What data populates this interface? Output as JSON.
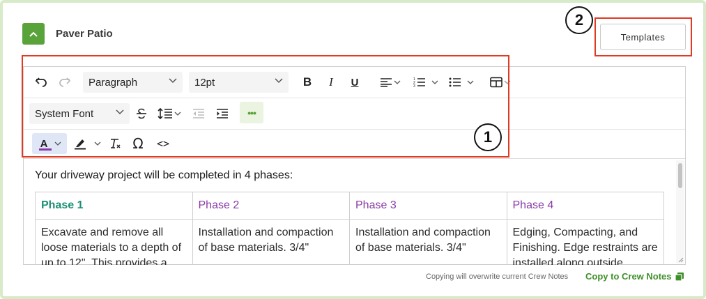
{
  "section": {
    "title": "Paver Patio"
  },
  "templates_button": {
    "label": "Templates"
  },
  "toolbar": {
    "block_format": "Paragraph",
    "font_size": "12pt",
    "font_family": "System Font",
    "bold": "B",
    "italic": "I",
    "underline": "U",
    "more": "•••",
    "text_color_letter": "A",
    "special_char": "Ω",
    "source_code": "<>"
  },
  "content": {
    "intro": "Your driveway project will be completed in 4 phases:",
    "phases": [
      {
        "title": "Phase 1",
        "text": "Excavate and remove all loose materials to a depth of up to 12\". This provides a"
      },
      {
        "title": "Phase 2",
        "text": "Installation and compaction of base materials. 3/4\""
      },
      {
        "title": "Phase 3",
        "text": "Installation and compaction of base materials. 3/4\""
      },
      {
        "title": "Phase 4",
        "text": "Edging, Compacting, and Finishing. Edge restraints are installed along outside"
      }
    ]
  },
  "footer": {
    "note": "Copying will overwrite current Crew Notes",
    "copy_link": "Copy to Crew Notes"
  },
  "annotations": {
    "one": "1",
    "two": "2"
  },
  "colors": {
    "accent_green": "#5aa33a",
    "card_border": "#d7ebc8",
    "annotation_red": "#e03a23",
    "phase1_teal": "#1d8f74",
    "phase_purple": "#8a3aa8",
    "text_color_swatch": "#8a3aa8"
  }
}
